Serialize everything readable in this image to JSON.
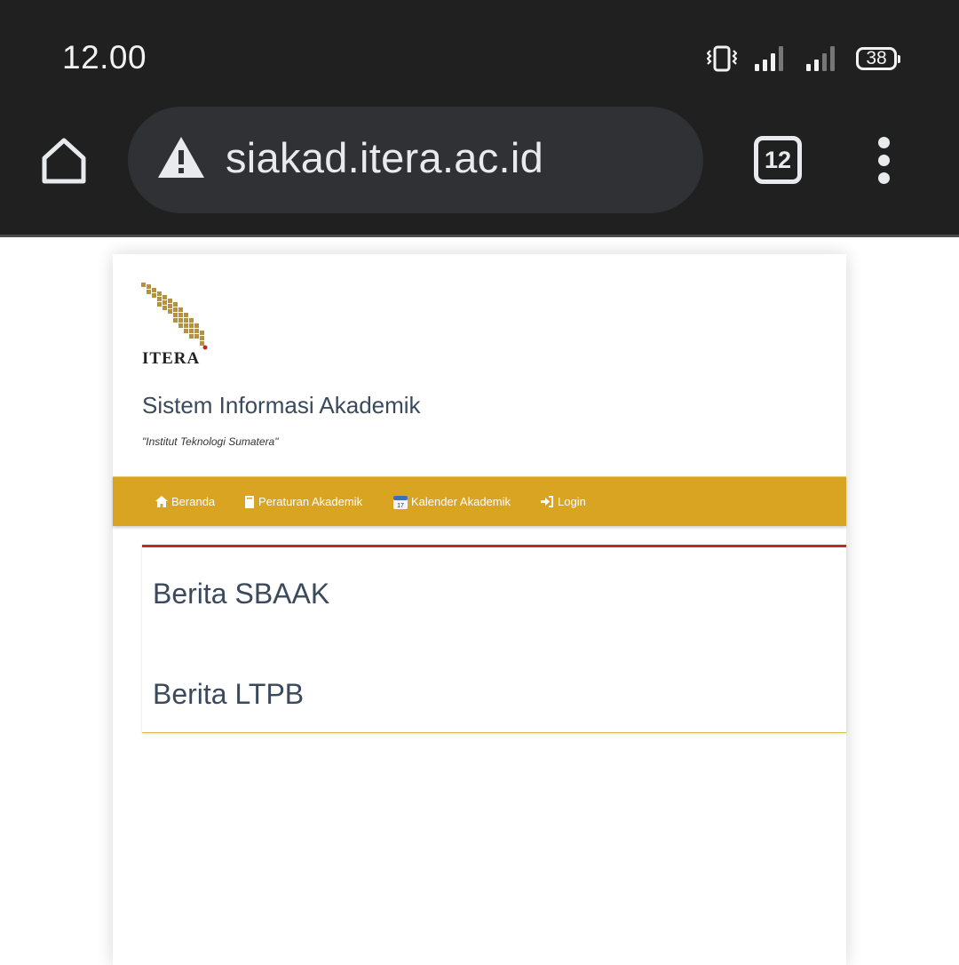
{
  "status_bar": {
    "time": "12.00",
    "battery_level": "38"
  },
  "browser": {
    "url": "siakad.itera.ac.id",
    "tab_count": "12",
    "icons": [
      "home-icon",
      "warning-icon",
      "tabs-icon",
      "more-vert-icon",
      "vibrate-icon",
      "signal-icon",
      "battery-icon"
    ]
  },
  "site": {
    "logo_text": "ITERA",
    "title": "Sistem Informasi Akademik",
    "tagline": "\"Institut Teknologi Sumatera\""
  },
  "nav": {
    "items": [
      {
        "label": "Beranda",
        "icon": "home-icon"
      },
      {
        "label": "Peraturan Akademik",
        "icon": "book-icon"
      },
      {
        "label": "Kalender Akademik",
        "icon": "calendar-icon"
      },
      {
        "label": "Login",
        "icon": "login-icon"
      }
    ]
  },
  "content": {
    "sections": [
      {
        "heading": "Berita SBAAK"
      },
      {
        "heading": "Berita LTPB"
      }
    ]
  },
  "colors": {
    "chrome_bg": "#202020",
    "urlbar_bg": "#303134",
    "navbar_bg": "#d9a421",
    "panel_top_border": "#c0292a",
    "heading_text": "#3a4a5c"
  }
}
